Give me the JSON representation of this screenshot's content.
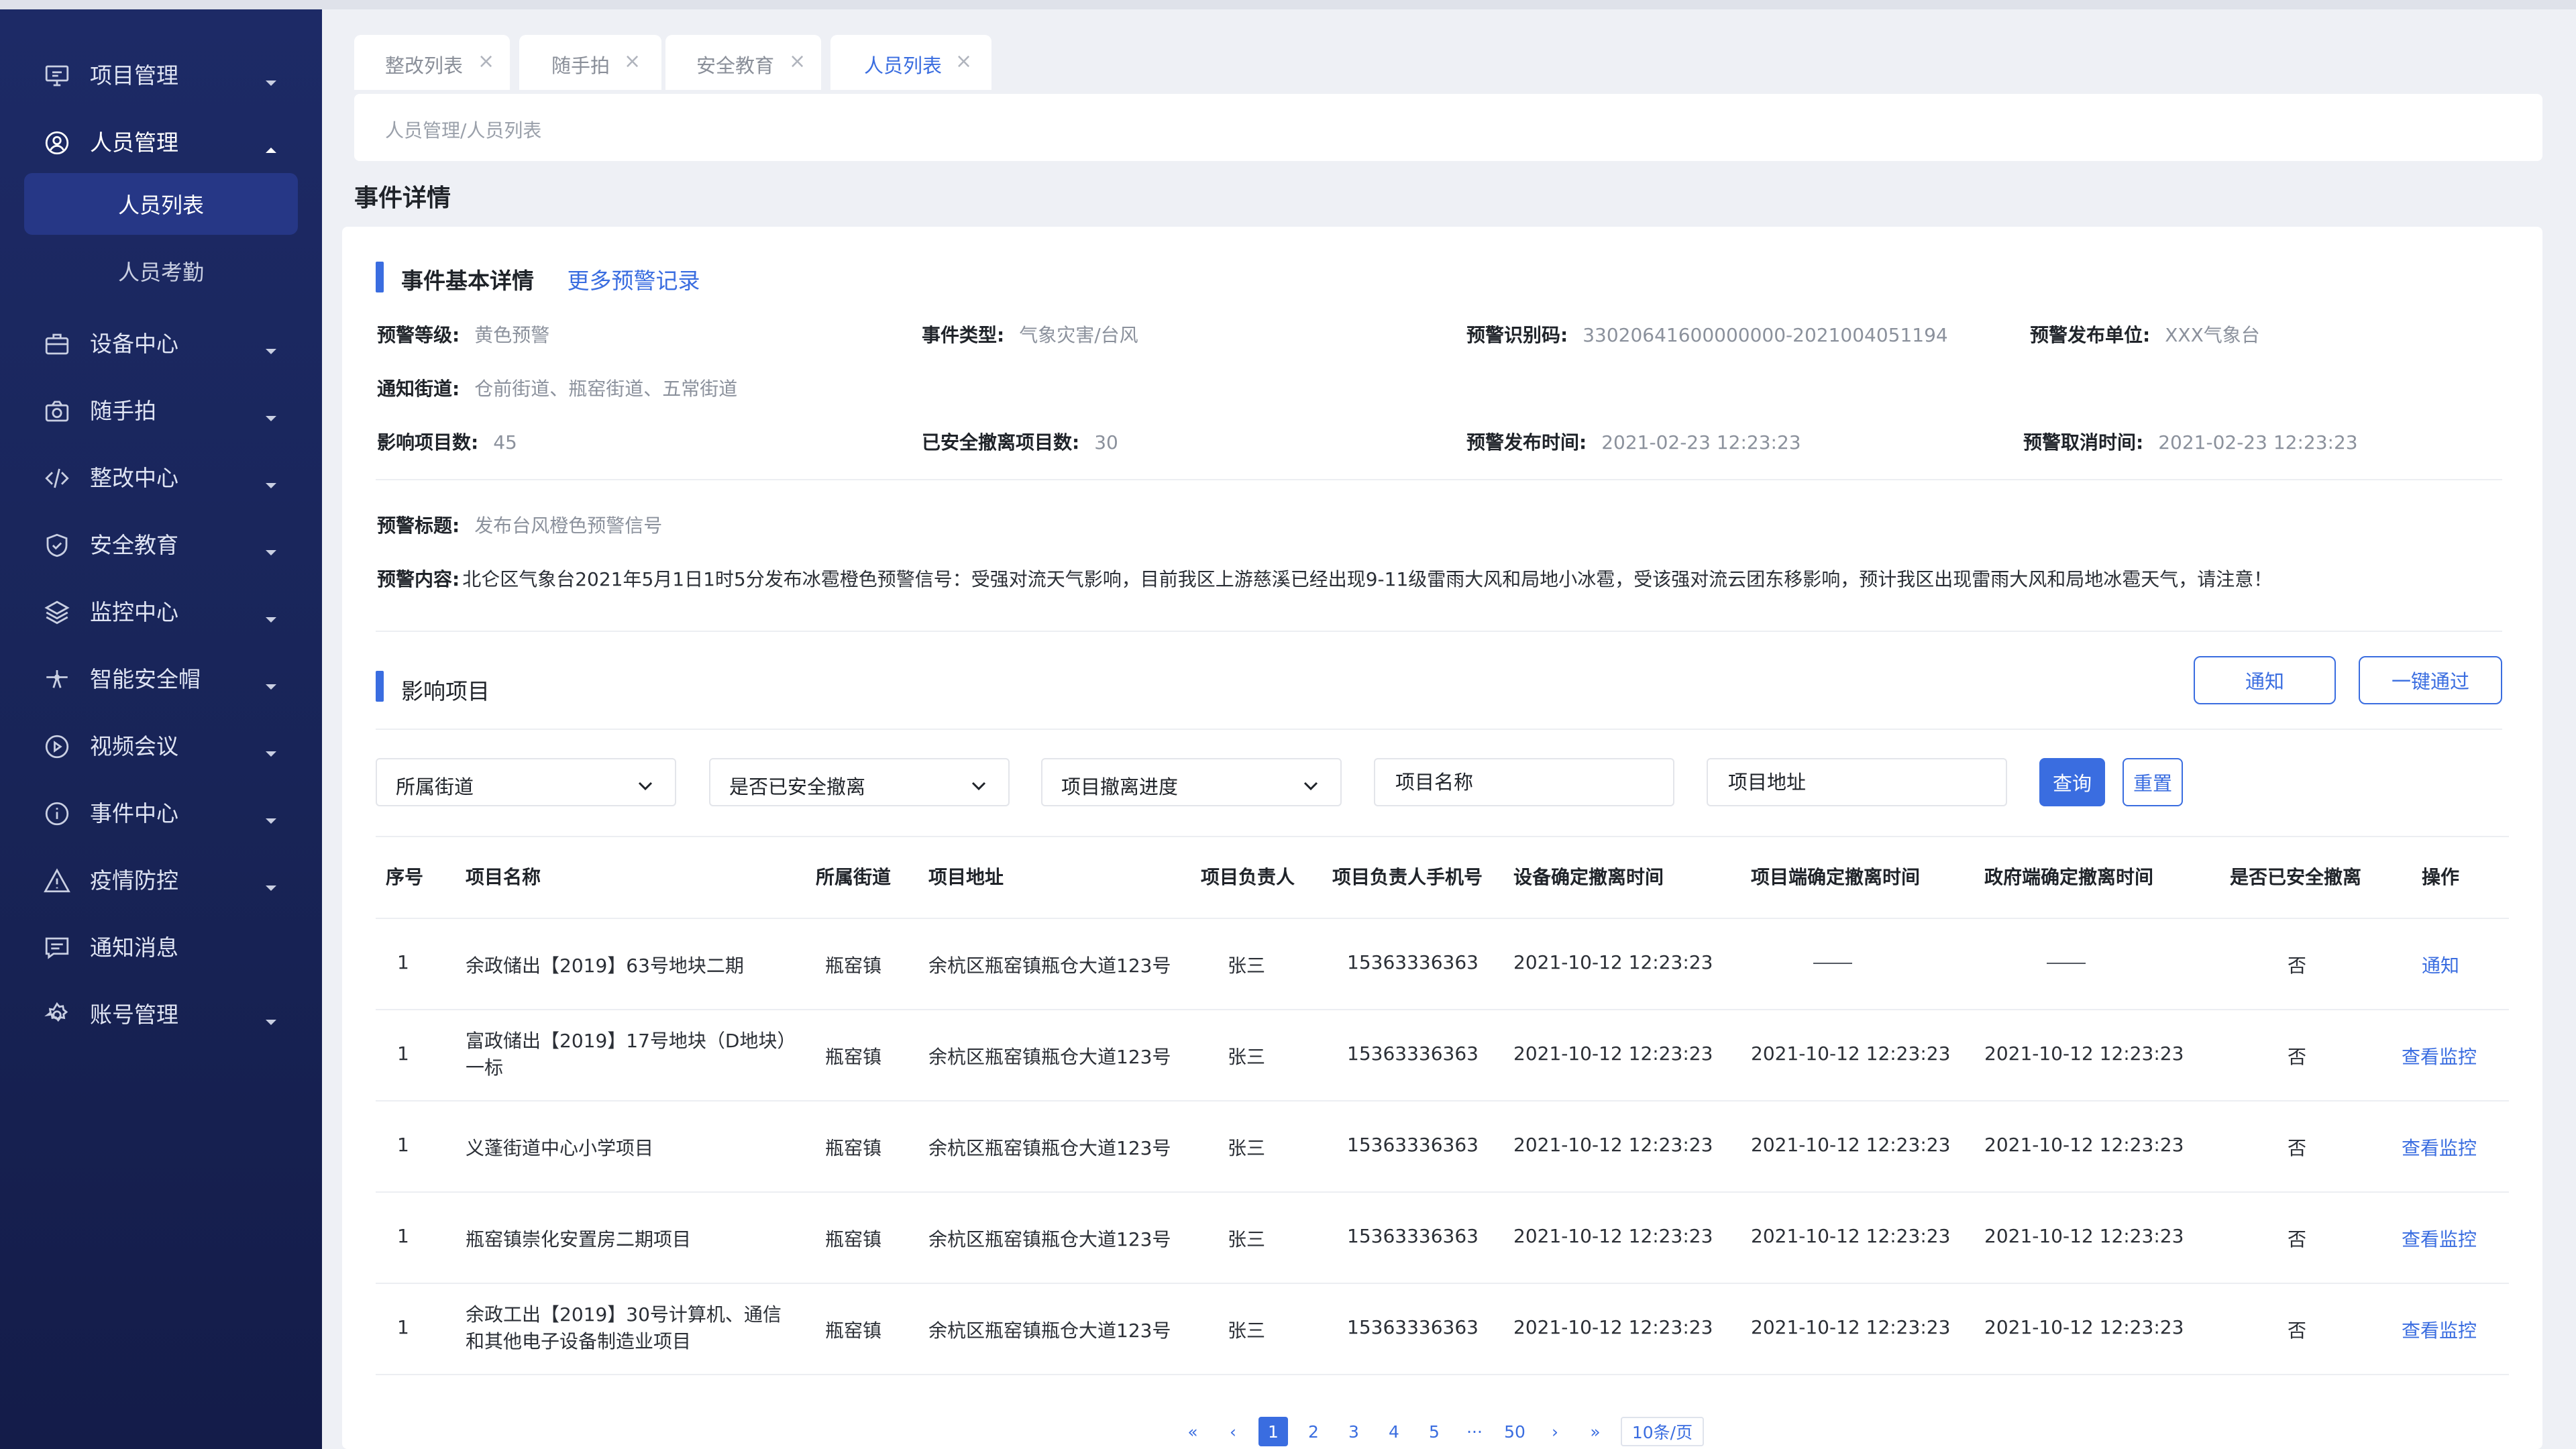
{
  "sidebar": {
    "items": [
      {
        "label": "项目管理",
        "icon": "monitor-icon"
      },
      {
        "label": "人员管理",
        "icon": "user-circle-icon"
      },
      {
        "label": "设备中心",
        "icon": "briefcase-icon"
      },
      {
        "label": "随手拍",
        "icon": "camera-icon"
      },
      {
        "label": "整改中心",
        "icon": "code-icon"
      },
      {
        "label": "安全教育",
        "icon": "shield-check-icon"
      },
      {
        "label": "监控中心",
        "icon": "layers-icon"
      },
      {
        "label": "智能安全帽",
        "icon": "drone-icon"
      },
      {
        "label": "视频会议",
        "icon": "play-circle-icon"
      },
      {
        "label": "事件中心",
        "icon": "info-circle-icon"
      },
      {
        "label": "疫情防控",
        "icon": "warning-triangle-icon"
      },
      {
        "label": "通知消息",
        "icon": "message-icon"
      },
      {
        "label": "账号管理",
        "icon": "gear-icon"
      }
    ],
    "subitems": [
      "人员列表",
      "人员考勤"
    ]
  },
  "tabs": [
    {
      "label": "整改列表",
      "close": "×"
    },
    {
      "label": "随手拍",
      "close": "×"
    },
    {
      "label": "安全教育",
      "close": "×"
    },
    {
      "label": "人员列表",
      "close": "×"
    }
  ],
  "breadcrumb": {
    "path": "人员管理/人员列表"
  },
  "page_title": "事件详情",
  "basic": {
    "title": "事件基本详情",
    "more_link": "更多预警记录",
    "fields": {
      "level": {
        "key": "预警等级:",
        "value": "黄色预警"
      },
      "type": {
        "key": "事件类型:",
        "value": "气象灾害/台风"
      },
      "code": {
        "key": "预警识别码:",
        "value": "33020641600000000-2021004051194"
      },
      "unit": {
        "key": "预警发布单位:",
        "value": "XXX气象台"
      },
      "streets": {
        "key": "通知街道:",
        "value": "仓前街道、瓶窑街道、五常街道"
      },
      "affected": {
        "key": "影响项目数:",
        "value": "45"
      },
      "evacuated": {
        "key": "已安全撤离项目数:",
        "value": "30"
      },
      "publish_time": {
        "key": "预警发布时间:",
        "value": "2021-02-23 12:23:23"
      },
      "cancel_time": {
        "key": "预警取消时间:",
        "value": "2021-02-23 12:23:23"
      },
      "warn_title": {
        "key": "预警标题:",
        "value": "发布台风橙色预警信号"
      },
      "warn_content": {
        "key": "预警内容:",
        "value": "北仑区气象台2021年5月1日1时5分发布冰雹橙色预警信号：受强对流天气影响，目前我区上游慈溪已经出现9-11级雷雨大风和局地小冰雹，受该强对流云团东移影响，预计我区出现雷雨大风和局地冰雹天气，请注意！"
      }
    }
  },
  "projects": {
    "title": "影响项目",
    "notify_button": "通知",
    "pass_button": "一键通过",
    "filters": {
      "street": "所属街道",
      "evacuated": "是否已安全撤离",
      "progress": "项目撤离进度",
      "name_placeholder": "项目名称",
      "address_placeholder": "项目地址",
      "query": "查询",
      "reset": "重置"
    },
    "columns": [
      "序号",
      "项目名称",
      "所属街道",
      "项目地址",
      "项目负责人",
      "项目负责人手机号",
      "设备确定撤离时间",
      "项目端确定撤离时间",
      "政府端确定撤离时间",
      "是否已安全撤离",
      "操作"
    ],
    "rows": [
      {
        "no": "1",
        "name": "余政储出【2019】63号地块二期",
        "street": "瓶窑镇",
        "address": "余杭区瓶窑镇瓶仓大道123号",
        "owner": "张三",
        "phone": "15363336363",
        "t1": "2021-10-12  12:23:23",
        "t2": "——",
        "t3": "——",
        "safe": "否",
        "action": "通知"
      },
      {
        "no": "1",
        "name": "富政储出【2019】17号地块（D地块）一标",
        "street": "瓶窑镇",
        "address": "余杭区瓶窑镇瓶仓大道123号",
        "owner": "张三",
        "phone": "15363336363",
        "t1": "2021-10-12  12:23:23",
        "t2": "2021-10-12  12:23:23",
        "t3": "2021-10-12  12:23:23",
        "safe": "否",
        "action": "查看监控"
      },
      {
        "no": "1",
        "name": "义蓬街道中心小学项目",
        "street": "瓶窑镇",
        "address": "余杭区瓶窑镇瓶仓大道123号",
        "owner": "张三",
        "phone": "15363336363",
        "t1": "2021-10-12  12:23:23",
        "t2": "2021-10-12  12:23:23",
        "t3": "2021-10-12  12:23:23",
        "safe": "否",
        "action": "查看监控"
      },
      {
        "no": "1",
        "name": "瓶窑镇崇化安置房二期项目",
        "street": "瓶窑镇",
        "address": "余杭区瓶窑镇瓶仓大道123号",
        "owner": "张三",
        "phone": "15363336363",
        "t1": "2021-10-12  12:23:23",
        "t2": "2021-10-12  12:23:23",
        "t3": "2021-10-12  12:23:23",
        "safe": "否",
        "action": "查看监控"
      },
      {
        "no": "1",
        "name": "余政工出【2019】30号计算机、通信和其他电子设备制造业项目",
        "street": "瓶窑镇",
        "address": "余杭区瓶窑镇瓶仓大道123号",
        "owner": "张三",
        "phone": "15363336363",
        "t1": "2021-10-12  12:23:23",
        "t2": "2021-10-12  12:23:23",
        "t3": "2021-10-12  12:23:23",
        "safe": "否",
        "action": "查看监控"
      }
    ]
  },
  "pagination": {
    "first": "«",
    "prev": "‹",
    "next": "›",
    "last": "»",
    "pages": [
      "1",
      "2",
      "3",
      "4",
      "5"
    ],
    "ellipsis": "···",
    "last_page": "50",
    "current": "1",
    "page_size": "10条/页"
  },
  "colors": {
    "accent": "#3a6de0",
    "sidebar": "#1d2a66",
    "sidebar_active": "#263786"
  }
}
